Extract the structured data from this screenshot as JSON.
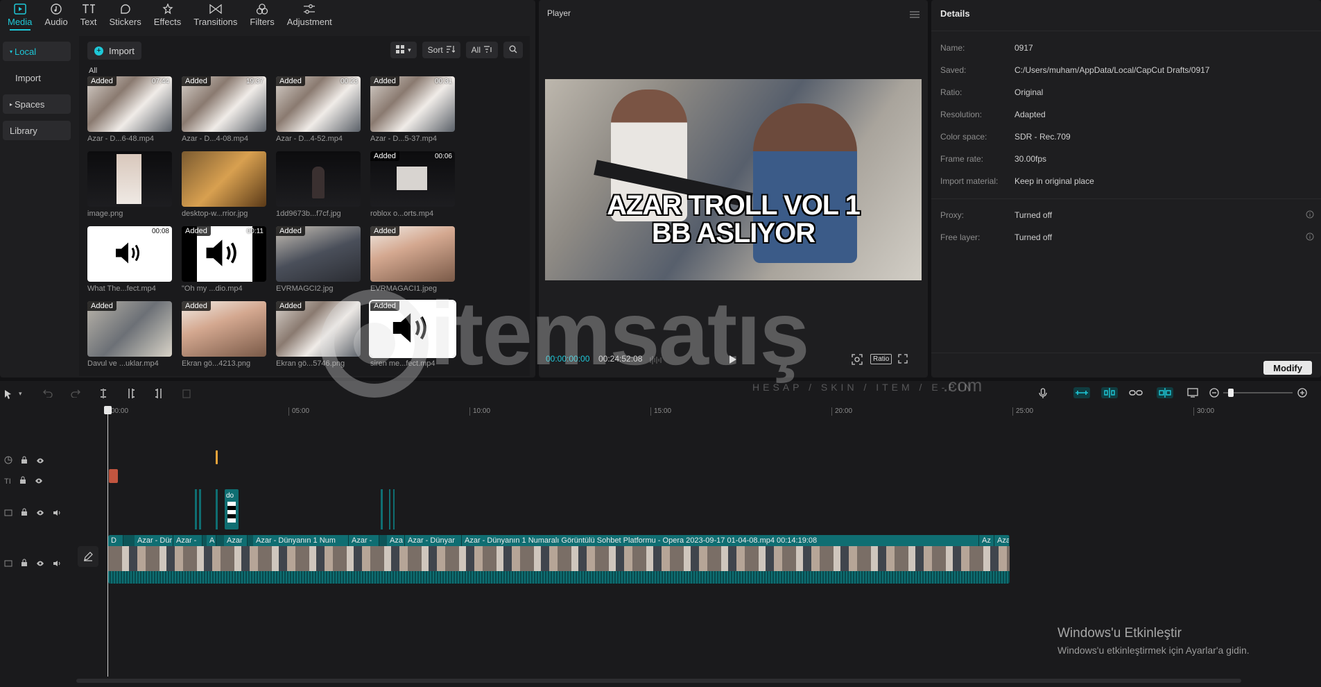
{
  "toolbar": {
    "tabs": [
      {
        "label": "Media",
        "icon": "media-icon"
      },
      {
        "label": "Audio",
        "icon": "audio-icon"
      },
      {
        "label": "Text",
        "icon": "text-icon"
      },
      {
        "label": "Stickers",
        "icon": "sticker-icon"
      },
      {
        "label": "Effects",
        "icon": "effects-icon"
      },
      {
        "label": "Transitions",
        "icon": "transitions-icon"
      },
      {
        "label": "Filters",
        "icon": "filters-icon"
      },
      {
        "label": "Adjustment",
        "icon": "adjustment-icon"
      }
    ]
  },
  "leftnav": {
    "local": "Local",
    "import": "Import",
    "spaces": "Spaces",
    "library": "Library"
  },
  "media": {
    "import_label": "Import",
    "sort_label": "Sort",
    "all_filter": "All",
    "section_all": "All",
    "items": [
      {
        "caption": "Azar - D...6-48.mp4",
        "added": "Added",
        "duration": "07:44"
      },
      {
        "caption": "Azar - D...4-08.mp4",
        "added": "Added",
        "duration": "19:37"
      },
      {
        "caption": "Azar - D...4-52.mp4",
        "added": "Added",
        "duration": "00:23"
      },
      {
        "caption": "Azar - D...5-37.mp4",
        "added": "Added",
        "duration": "00:31"
      },
      {
        "caption": "image.png",
        "added": "",
        "duration": ""
      },
      {
        "caption": "desktop-w...rrior.jpg",
        "added": "",
        "duration": ""
      },
      {
        "caption": "1dd9673b...f7cf.jpg",
        "added": "",
        "duration": ""
      },
      {
        "caption": "roblox o...orts.mp4",
        "added": "Added",
        "duration": "00:06"
      },
      {
        "caption": "What The...fect.mp4",
        "added": "",
        "duration": "00:08"
      },
      {
        "caption": "\"Oh my ...dio.mp4",
        "added": "Added",
        "duration": "00:11"
      },
      {
        "caption": "EVRMAGCI2.jpg",
        "added": "Added",
        "duration": ""
      },
      {
        "caption": "EVRMAGACI1.jpeg",
        "added": "Added",
        "duration": ""
      },
      {
        "caption": "Davul ve ...uklar.mp4",
        "added": "Added",
        "duration": ""
      },
      {
        "caption": "Ekran gö...4213.png",
        "added": "Added",
        "duration": ""
      },
      {
        "caption": "Ekran gö...5746.png",
        "added": "Added",
        "duration": ""
      },
      {
        "caption": "siren me...fect.mp4",
        "added": "Added",
        "duration": ""
      }
    ]
  },
  "player": {
    "title": "Player",
    "caption_line1": "AZAR TROLL VOL 1",
    "caption_line2": "BB ASLIYOR",
    "current_time": "00:00:00:00",
    "total_time": "00:24:52:08",
    "ratio_label": "Ratio"
  },
  "details": {
    "title": "Details",
    "rows": [
      {
        "key": "Name:",
        "value": "0917"
      },
      {
        "key": "Saved:",
        "value": "C:/Users/muham/AppData/Local/CapCut Drafts/0917"
      },
      {
        "key": "Ratio:",
        "value": "Original"
      },
      {
        "key": "Resolution:",
        "value": "Adapted"
      },
      {
        "key": "Color space:",
        "value": "SDR - Rec.709"
      },
      {
        "key": "Frame rate:",
        "value": "30.00fps"
      },
      {
        "key": "Import material:",
        "value": "Keep in original place"
      }
    ],
    "rows2": [
      {
        "key": "Proxy:",
        "value": "Turned off"
      },
      {
        "key": "Free layer:",
        "value": "Turned off"
      }
    ],
    "modify_label": "Modify"
  },
  "timeline": {
    "ruler": [
      "00:00",
      "05:00",
      "10:00",
      "15:00",
      "20:00",
      "25:00",
      "30:00"
    ],
    "small_clip_label": "do",
    "clip_labels": [
      "D",
      "Azar - Dür",
      "Azar -",
      "A",
      "Azar",
      "Azar - Dünyanın 1 Num",
      "Azar -",
      "Aza",
      "Azar - Dünyar",
      "Azar - Dünyanın 1 Numaralı Görüntülü Sohbet Platformu - Opera 2023-09-17 01-04-08.mp4   00:14:19:08",
      "Az",
      "Aza"
    ]
  },
  "watermark": {
    "brand": "itemsatış",
    "tagline": "HESAP / SKIN / ITEM / E-PIN",
    "domain": ".com"
  },
  "windows_activation": {
    "title": "Windows'u Etkinleştir",
    "subtitle": "Windows'u etkinleştirmek için Ayarlar'a gidin."
  },
  "colors": {
    "accent": "#1ec8d8",
    "clip_bg": "#0c5558",
    "panel_bg": "#1e1e20"
  }
}
